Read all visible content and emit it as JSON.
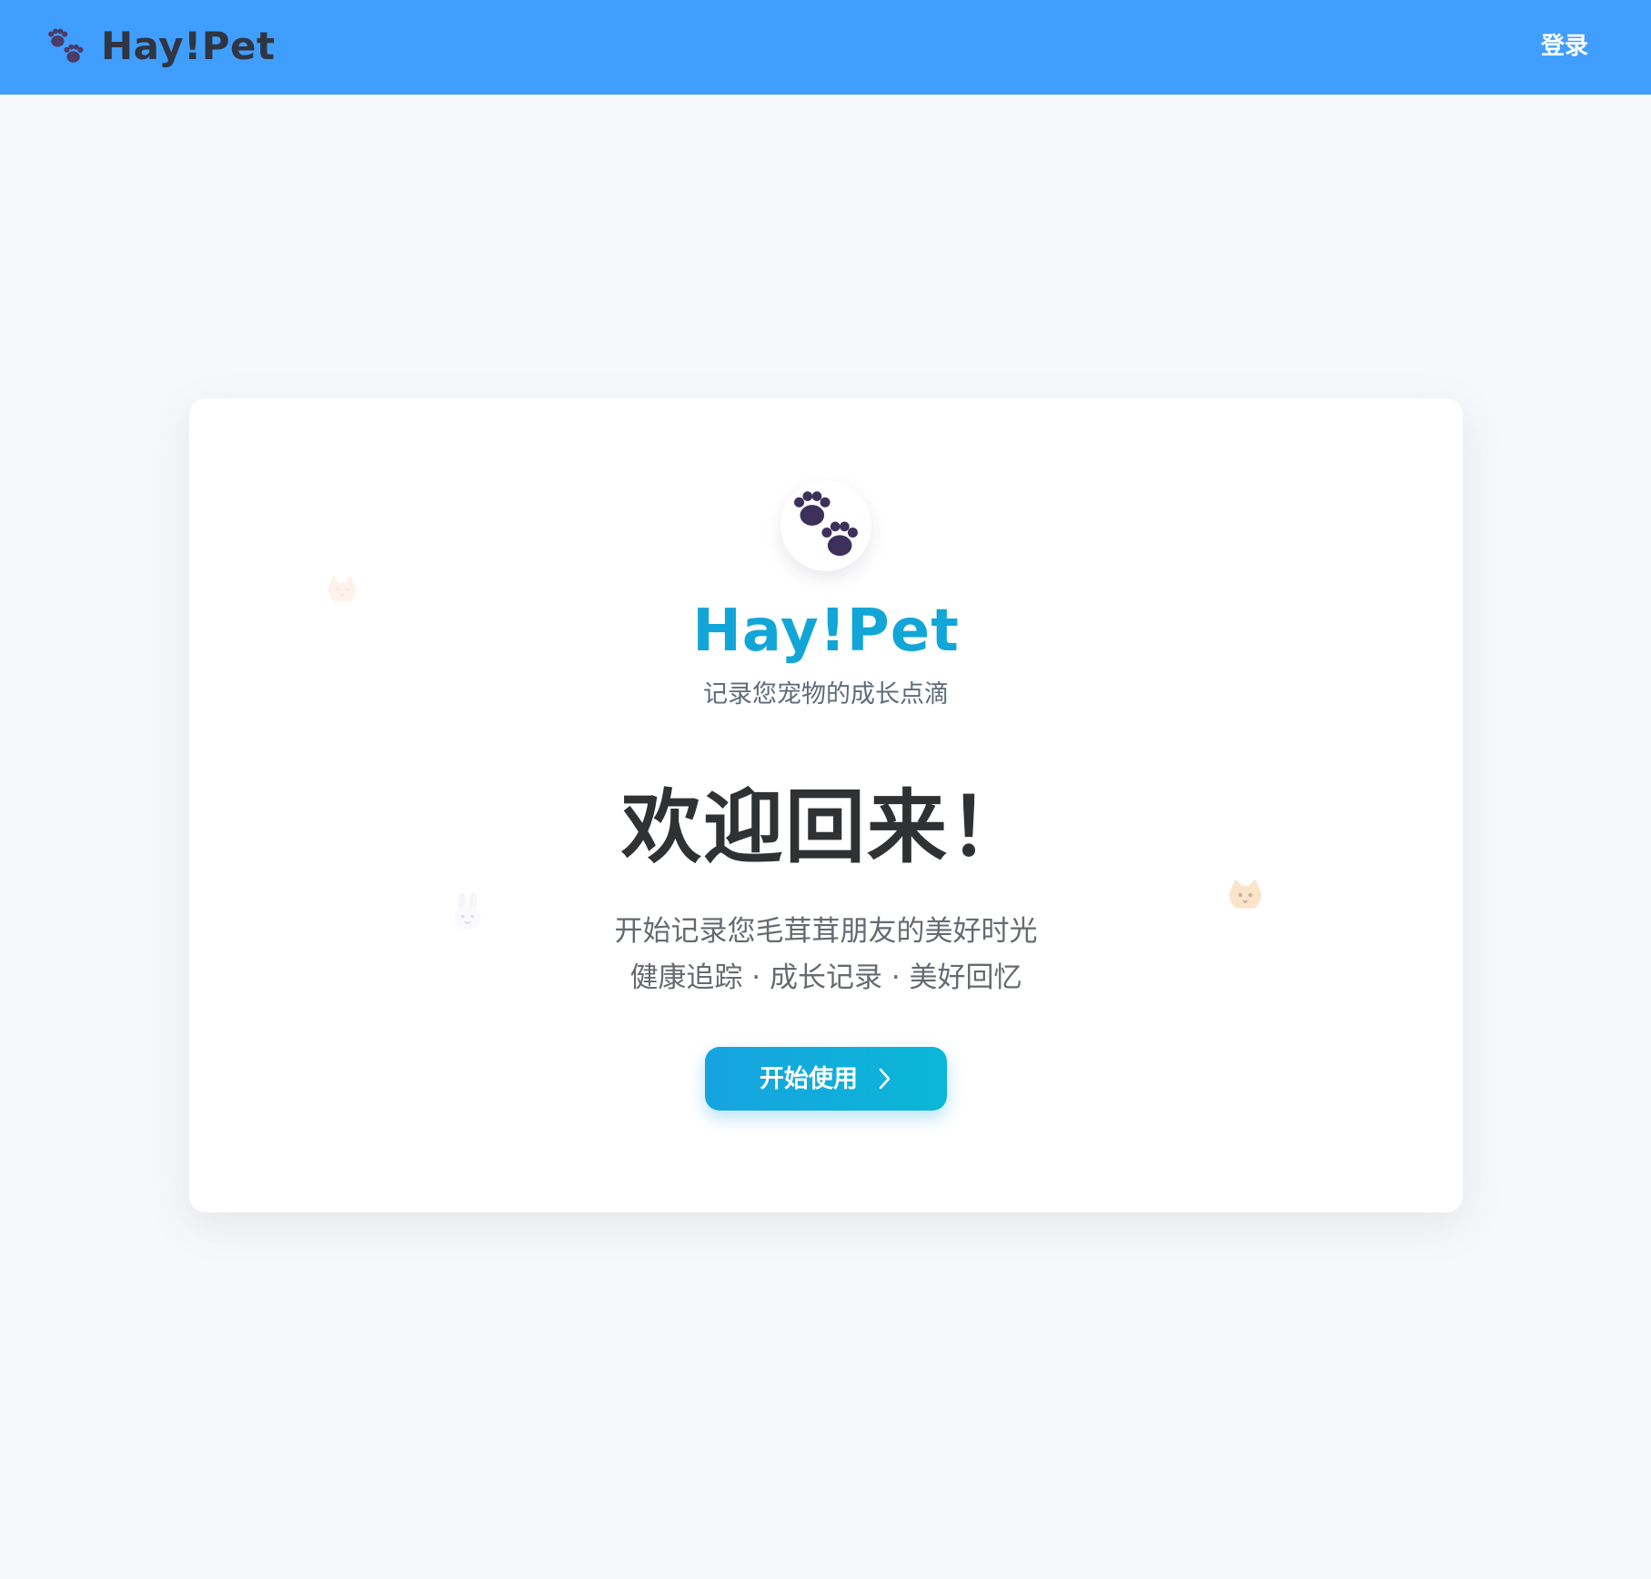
{
  "header": {
    "brand_icon": "paw-prints-icon",
    "brand_name": "Hay!Pet",
    "login_label": "登录",
    "background_color": "#409eff"
  },
  "hero": {
    "icon": "paw-prints-icon",
    "app_name": "Hay!Pet",
    "tagline": "记录您宠物的成长点滴",
    "welcome": "欢迎回来！",
    "subtitle_line1": "开始记录您毛茸茸朋友的美好时光",
    "subtitle_line2": "健康追踪 · 成长记录 · 美好回忆",
    "start_button_label": "开始使用",
    "start_button_icon": "chevron-right-icon",
    "accent_color": "#12a6d8"
  },
  "decorations": [
    "cat-icon",
    "rabbit-icon",
    "cat-face-icon"
  ],
  "page": {
    "background_color": "#f7f8fa",
    "card_color": "#ffffff"
  }
}
